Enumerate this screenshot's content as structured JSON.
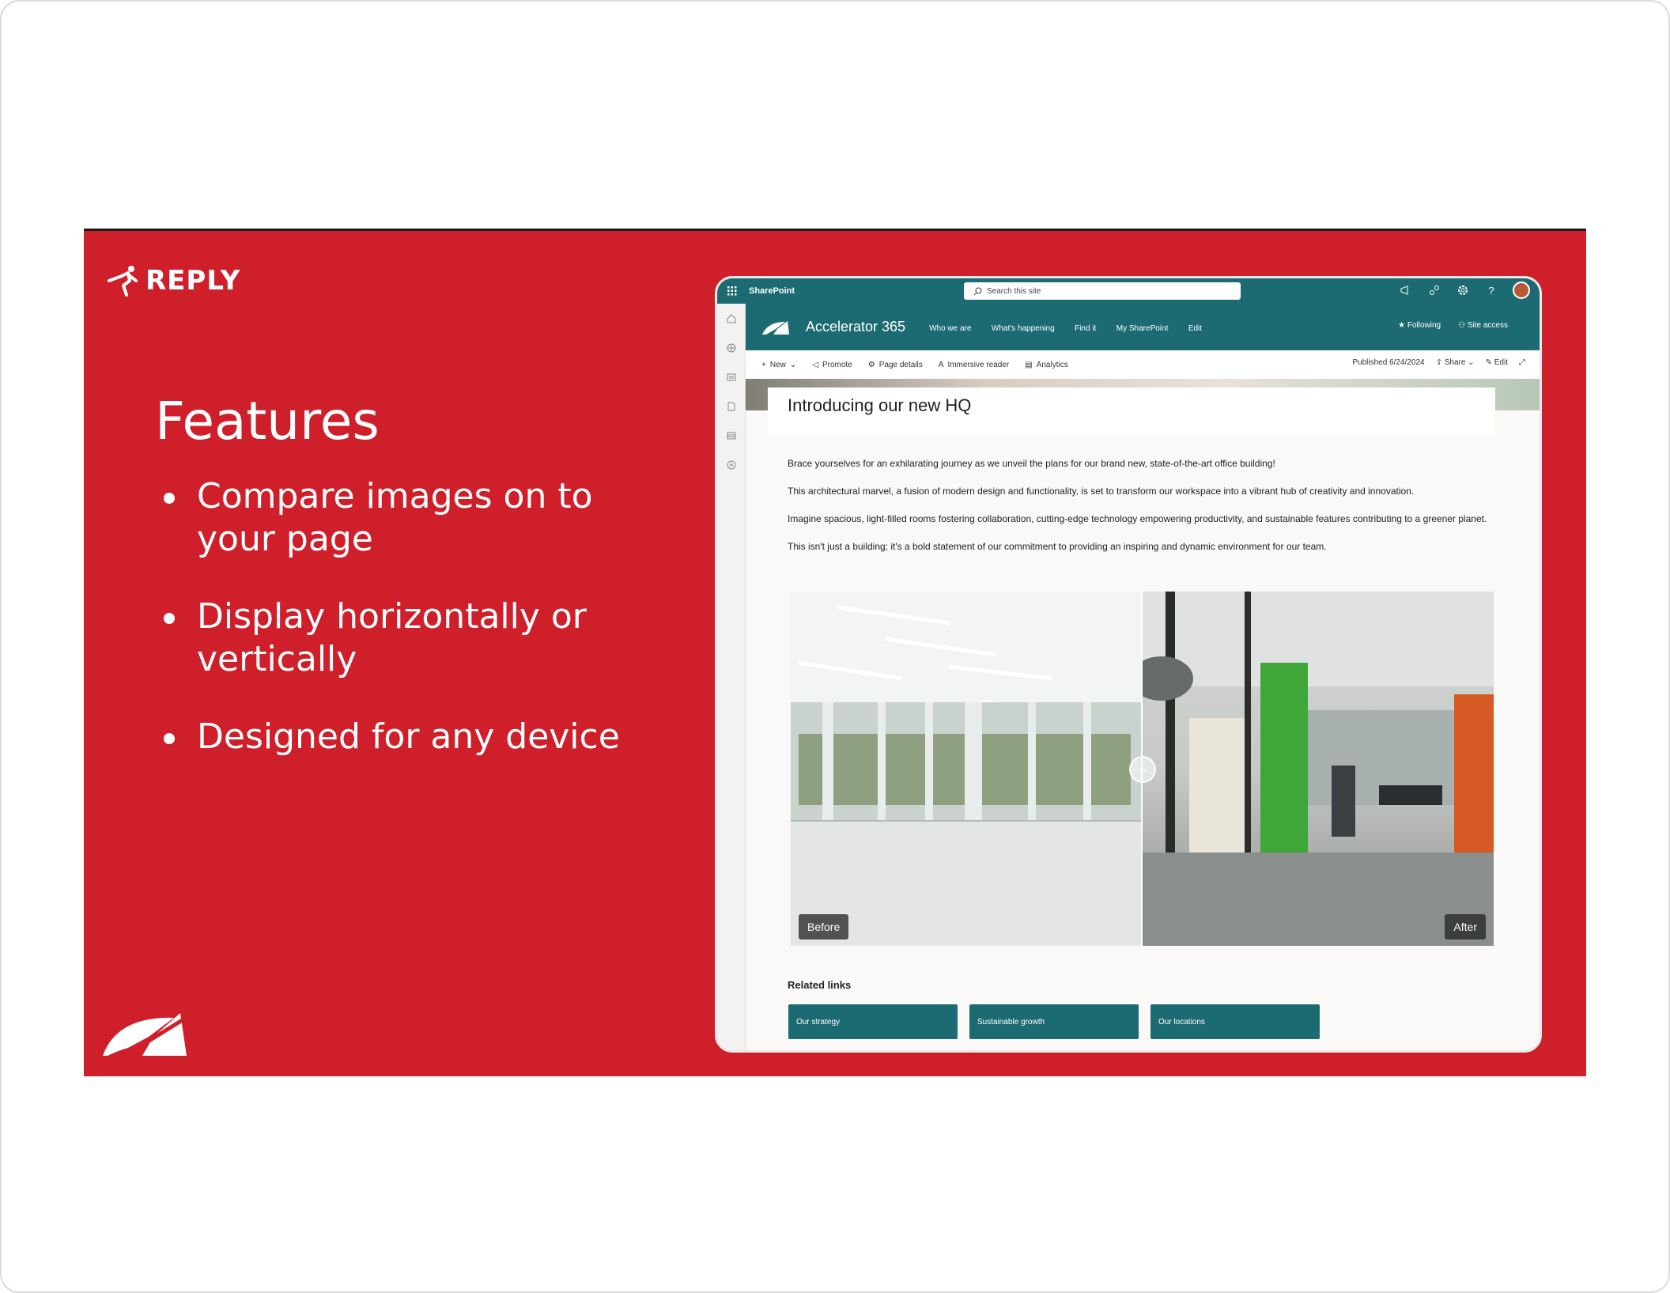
{
  "slide": {
    "brand": "REPLY",
    "title": "Features",
    "bullets": [
      "Compare images on to your page",
      "Display horizontally or vertically",
      "Designed for any device"
    ],
    "background_color": "#cf1f2a"
  },
  "sharepoint": {
    "app_name": "SharePoint",
    "search_placeholder": "Search this site",
    "site_title": "Accelerator 365",
    "nav": [
      "Who we are",
      "What's happening",
      "Find it",
      "My SharePoint",
      "Edit"
    ],
    "following_label": "Following",
    "site_access_label": "Site access",
    "commands": [
      "New",
      "Promote",
      "Page details",
      "Immersive reader",
      "Analytics"
    ],
    "published": "Published 6/24/2024",
    "share_label": "Share",
    "edit_label": "Edit",
    "page_title": "Introducing our new HQ",
    "paragraphs": [
      "Brace yourselves for an exhilarating journey as we unveil the plans for our brand new, state-of-the-art office building!",
      "This architectural marvel, a fusion of modern design and functionality, is set to transform our workspace into a vibrant hub of creativity and innovation.",
      "Imagine spacious, light-filled rooms fostering collaboration, cutting-edge technology empowering productivity, and sustainable features contributing to a greener planet.",
      "This isn't just a building; it's a bold statement of our commitment to providing an inspiring and dynamic environment for our team."
    ],
    "compare": {
      "before_label": "Before",
      "after_label": "After"
    },
    "related_title": "Related links",
    "related_links": [
      "Our strategy",
      "Sustainable growth",
      "Our locations"
    ],
    "accent_color": "#1d6b72"
  }
}
